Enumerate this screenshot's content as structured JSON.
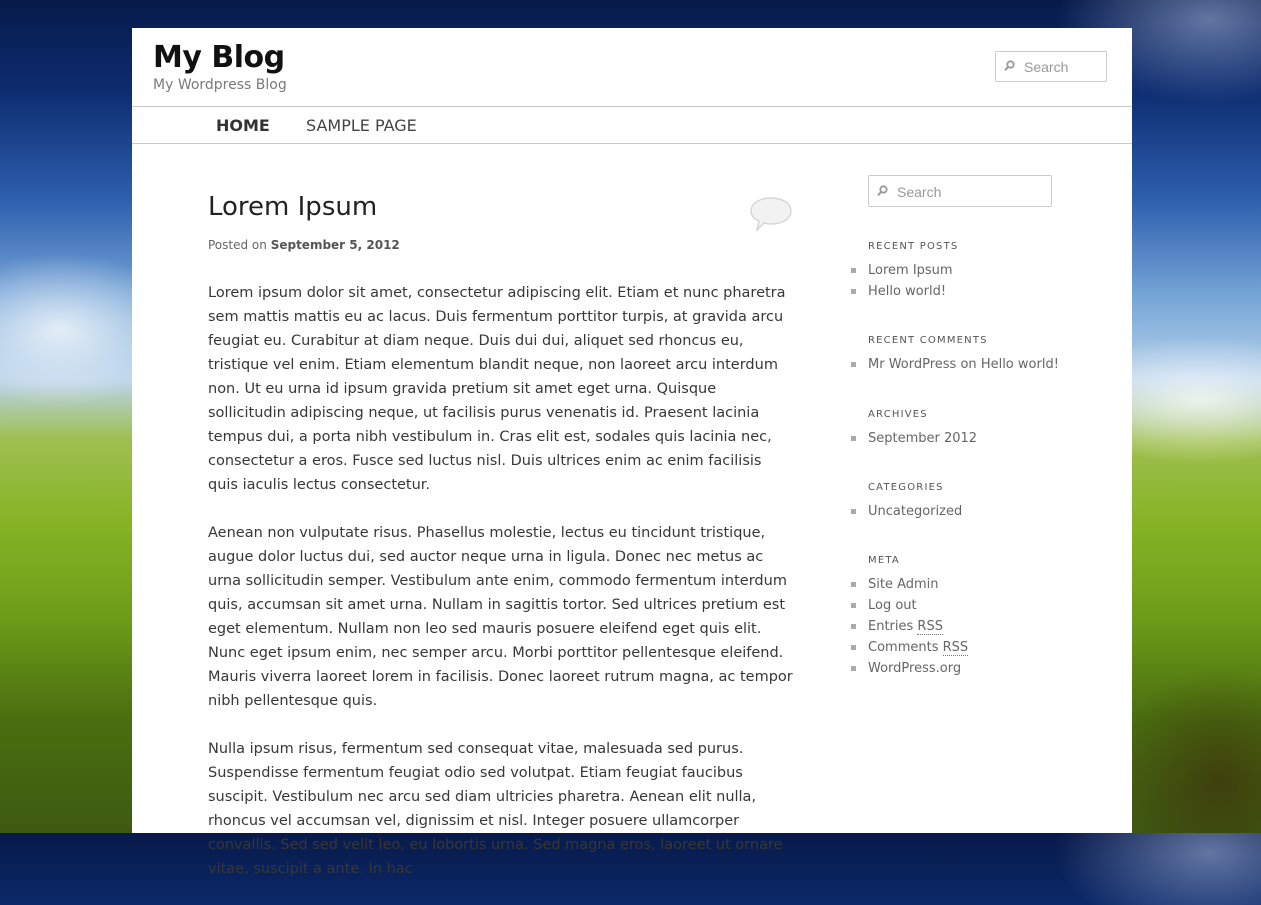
{
  "header": {
    "site_title": "My Blog",
    "site_description": "My Wordpress Blog",
    "search_placeholder": "Search"
  },
  "nav": {
    "items": [
      {
        "label": "HOME",
        "current": true
      },
      {
        "label": "SAMPLE PAGE",
        "current": false
      }
    ]
  },
  "post": {
    "title": "Lorem Ipsum",
    "posted_on_label": "Posted on",
    "date": "September 5, 2012",
    "paragraphs": [
      "Lorem ipsum dolor sit amet, consectetur adipiscing elit. Etiam et nunc pharetra sem mattis mattis eu ac lacus. Duis fermentum porttitor turpis, at gravida arcu feugiat eu. Curabitur at diam neque. Duis dui dui, aliquet sed rhoncus eu, tristique vel enim. Etiam elementum blandit neque, non laoreet arcu interdum non. Ut eu urna id ipsum gravida pretium sit amet eget urna. Quisque sollicitudin adipiscing neque, ut facilisis purus venenatis id. Praesent lacinia tempus dui, a porta nibh vestibulum in. Cras elit est, sodales quis lacinia nec, consectetur a eros. Fusce sed luctus nisl. Duis ultrices enim ac enim facilisis quis iaculis lectus consectetur.",
      "Aenean non vulputate risus. Phasellus molestie, lectus eu tincidunt tristique, augue dolor luctus dui, sed auctor neque urna in ligula. Donec nec metus ac urna sollicitudin semper. Vestibulum ante enim, commodo fermentum interdum quis, accumsan sit amet urna. Nullam in sagittis tortor. Sed ultrices pretium est eget elementum. Nullam non leo sed mauris posuere eleifend eget quis elit. Nunc eget ipsum enim, nec semper arcu. Morbi porttitor pellentesque eleifend. Mauris viverra laoreet lorem in facilisis. Donec laoreet rutrum magna, ac tempor nibh pellentesque quis.",
      "Nulla ipsum risus, fermentum sed consequat vitae, malesuada sed purus. Suspendisse fermentum feugiat odio sed volutpat. Etiam feugiat faucibus suscipit. Vestibulum nec arcu sed diam ultricies pharetra. Aenean elit nulla, rhoncus vel accumsan vel, dignissim et nisl. Integer posuere ullamcorper convallis. Sed sed velit leo, eu lobortis urna. Sed magna eros, laoreet ut ornare vitae, suscipit a ante. In hac"
    ]
  },
  "sidebar": {
    "search_placeholder": "Search",
    "recent_posts": {
      "title": "RECENT POSTS",
      "items": [
        "Lorem Ipsum",
        "Hello world!"
      ]
    },
    "recent_comments": {
      "title": "RECENT COMMENTS",
      "author": "Mr WordPress",
      "on": "on",
      "post": "Hello world!"
    },
    "archives": {
      "title": "ARCHIVES",
      "items": [
        "September 2012"
      ]
    },
    "categories": {
      "title": "CATEGORIES",
      "items": [
        "Uncategorized"
      ]
    },
    "meta": {
      "title": "META",
      "site_admin": "Site Admin",
      "log_out": "Log out",
      "entries": "Entries",
      "comments": "Comments",
      "rss": "RSS",
      "wordpress_org": "WordPress.org"
    }
  },
  "icons": {
    "search": "search-icon",
    "comment": "comment-bubble-icon"
  }
}
